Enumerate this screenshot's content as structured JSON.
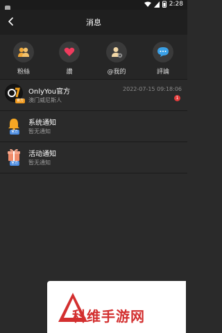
{
  "status": {
    "time": "2:28"
  },
  "header": {
    "title": "消息"
  },
  "quick_actions": [
    {
      "label": "粉絲",
      "icon": "fans-icon"
    },
    {
      "label": "讚",
      "icon": "heart-icon"
    },
    {
      "label": "@我的",
      "icon": "mention-icon"
    },
    {
      "label": "評論",
      "icon": "comment-icon"
    }
  ],
  "messages": [
    {
      "name": "OnlyYou官方",
      "subtitle": "澳门威尼斯人",
      "time": "2022-07-15 09:18:06",
      "badge": "1",
      "tag": "官方"
    },
    {
      "name": "系统通知",
      "subtitle": "暂无通知",
      "tag": "官方"
    },
    {
      "name": "活动通知",
      "subtitle": "暂无通知",
      "tag": "官方"
    }
  ],
  "watermark": {
    "text": "科维手游网"
  },
  "colors": {
    "accent_red": "#e33c3c",
    "orange": "#f09a1f",
    "blue": "#4a8be0"
  }
}
